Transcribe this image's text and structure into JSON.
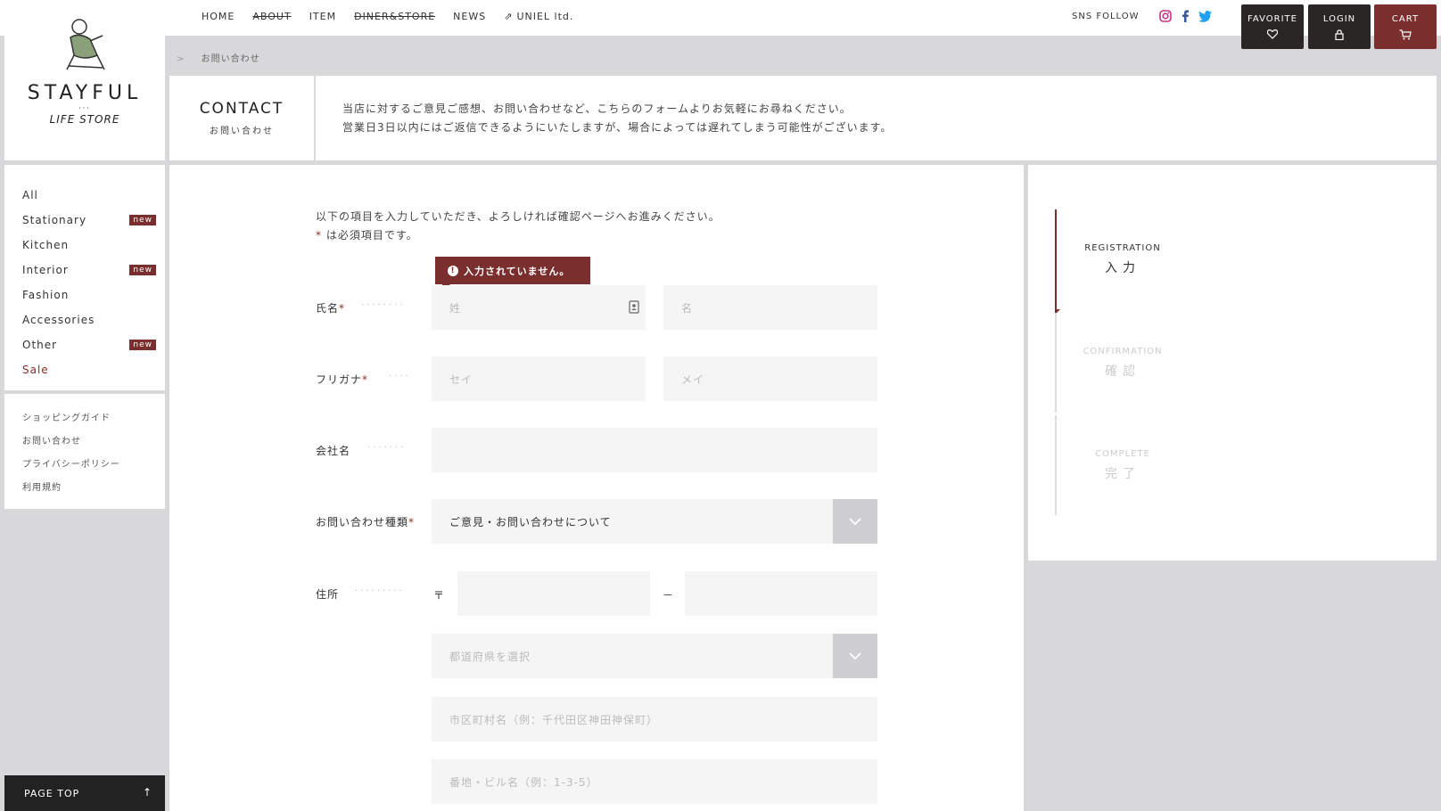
{
  "brand": {
    "name": "STAYFUL",
    "sub": "LIFE STORE"
  },
  "nav": {
    "items": [
      {
        "label": "HOME",
        "strike": false
      },
      {
        "label": "ABOUT",
        "strike": true
      },
      {
        "label": "ITEM",
        "strike": false
      },
      {
        "label": "DINER&STORE",
        "strike": true
      },
      {
        "label": "NEWS",
        "strike": false
      },
      {
        "label": "UNIEL ltd.",
        "strike": false
      }
    ]
  },
  "sns": {
    "label": "SNS FOLLOW",
    "colors": {
      "instagram": "#c13584",
      "facebook": "#3b5998",
      "twitter": "#1da1f2"
    }
  },
  "buttons": {
    "favorite": "FAVORITE",
    "login": "LOGIN",
    "cart": "CART"
  },
  "breadcrumb": {
    "sep": ">",
    "current": "お問い合わせ"
  },
  "contact": {
    "title_en": "CONTACT",
    "title_jp": "お問い合わせ",
    "intro_line1": "当店に対するご意見ご感想、お問い合わせなど、こちらのフォームよりお気軽にお尋ねください。",
    "intro_line2": "営業日3日以内にはご返信できるようにいたしますが、場合によっては遅れてしまう可能性がございます。"
  },
  "categories": [
    {
      "label": "All",
      "badge": ""
    },
    {
      "label": "Stationary",
      "badge": "new"
    },
    {
      "label": "Kitchen",
      "badge": ""
    },
    {
      "label": "Interior",
      "badge": "new"
    },
    {
      "label": "Fashion",
      "badge": ""
    },
    {
      "label": "Accessories",
      "badge": ""
    },
    {
      "label": "Other",
      "badge": "new"
    },
    {
      "label": "Sale",
      "badge": ""
    }
  ],
  "guide": [
    "ショッピングガイド",
    "お問い合わせ",
    "プライバシーポリシー",
    "利用規約"
  ],
  "pagetop": "PAGE TOP",
  "form": {
    "note_line1": "以下の項目を入力していただき、よろしければ確認ページへお進みください。",
    "note_line2_star": "*",
    "note_line2": " は必須項目です。",
    "required_mark": "*",
    "tooltip": "入力されていません。",
    "name_label": "氏名",
    "name_last_ph": "姓",
    "name_first_ph": "名",
    "kana_label": "フリガナ",
    "kana_last_ph": "セイ",
    "kana_first_ph": "メイ",
    "company_label": "会社名",
    "type_label": "お問い合わせ種類",
    "type_value": "ご意見・お問い合わせについて",
    "address_label": "住所",
    "postal_mark": "〒",
    "postal_dash": "－",
    "pref_ph": "都道府県を選択",
    "city_ph": "市区町村名（例：千代田区神田神保町）",
    "street_ph": "番地・ビル名（例：1-3-5）"
  },
  "steps": [
    {
      "en": "REGISTRATION",
      "jp": "入力",
      "active": true
    },
    {
      "en": "CONFIRMATION",
      "jp": "確認",
      "active": false
    },
    {
      "en": "COMPLETE",
      "jp": "完了",
      "active": false
    }
  ],
  "accent": "#7a2e2e"
}
